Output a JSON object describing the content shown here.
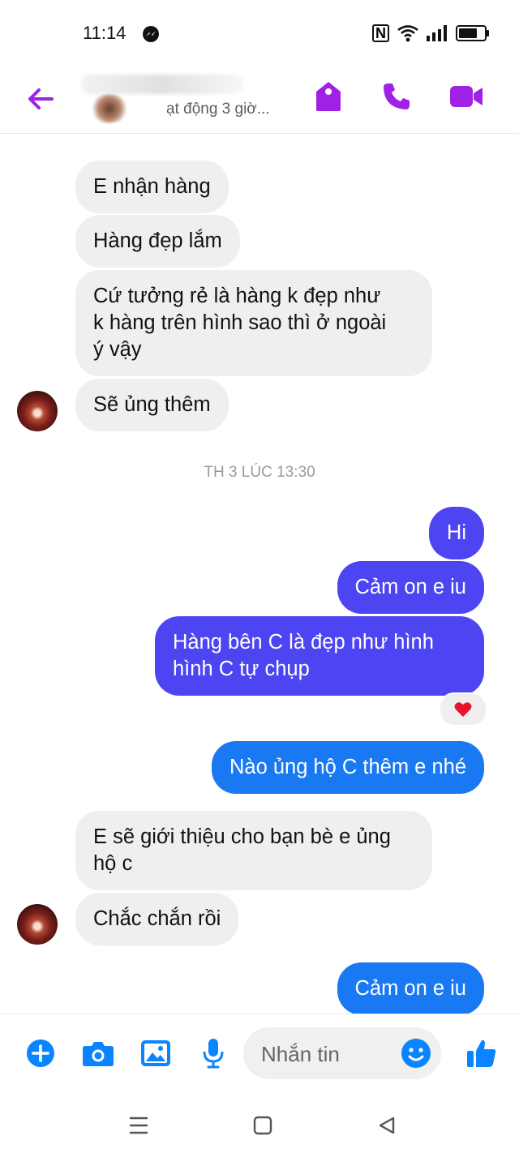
{
  "status_bar": {
    "time": "11:14"
  },
  "header": {
    "active_status": "ạt động 3 giờ..."
  },
  "messages": [
    {
      "text": "E nhận hàng"
    },
    {
      "text": "Hàng đẹp lắm"
    },
    {
      "text": "Cứ tưởng rẻ là hàng k đẹp như\nk hàng trên hình sao thì ở ngoài\ný vậy"
    },
    {
      "text": "Sẽ ủng thêm"
    },
    {
      "text": "Hi"
    },
    {
      "text": "Cảm on e iu"
    },
    {
      "text": "Hàng bên C là đẹp như hình\nhình C tự chụp"
    },
    {
      "text": "Nào ủng hộ C thêm e nhé"
    },
    {
      "text": "E sẽ giới thiệu cho bạn bè e ủng\nhộ c"
    },
    {
      "text": "Chắc chắn rồi"
    },
    {
      "text": "Cảm on e iu"
    }
  ],
  "timestamp": "TH 3 LÚC 13:30",
  "reaction": "heart",
  "composer": {
    "placeholder": "Nhắn tin"
  },
  "colors": {
    "accent_purple": "#a021e6",
    "sent_purple": "#4d45f1",
    "sent_blue": "#1879f2",
    "icon_blue": "#0a84ff",
    "received_gray": "#efefef"
  }
}
